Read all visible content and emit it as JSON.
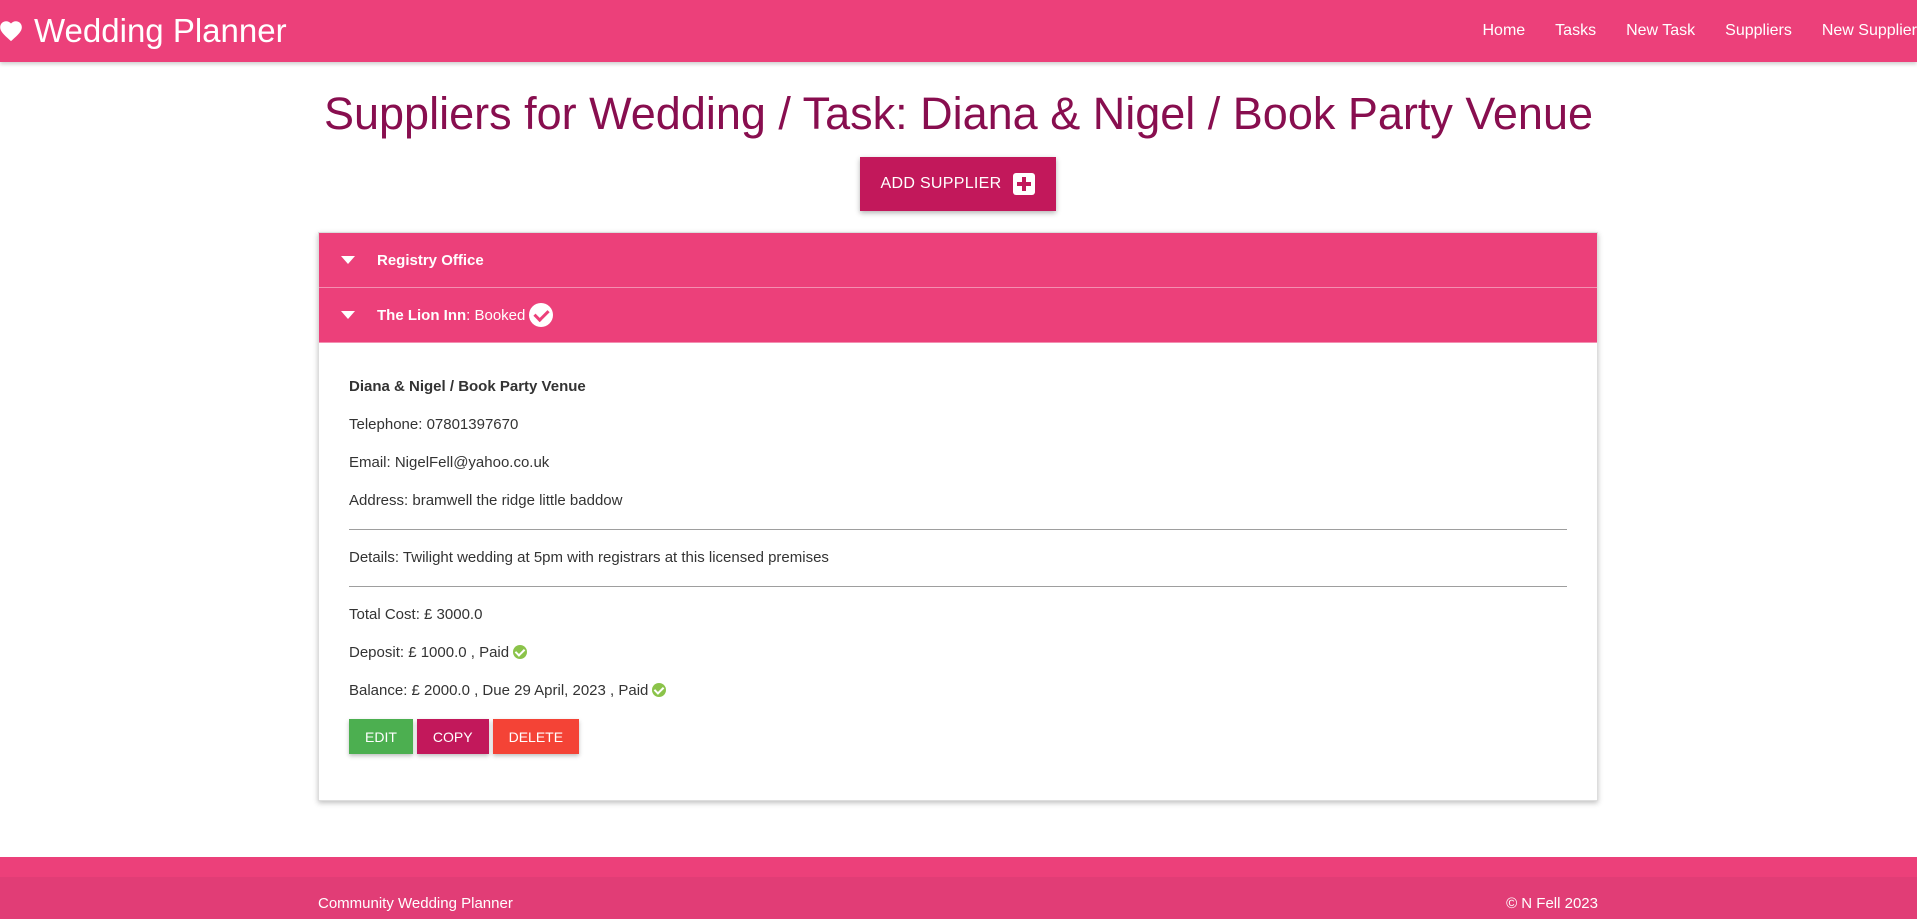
{
  "navbar": {
    "brand": "Wedding Planner",
    "links": [
      "Home",
      "Tasks",
      "New Task",
      "Suppliers",
      "New Supplier"
    ],
    "color": "#ec407a"
  },
  "page": {
    "title": "Suppliers for Wedding / Task: Diana & Nigel / Book Party Venue",
    "add_button": "ADD SUPPLIER"
  },
  "suppliers": [
    {
      "name": "Registry Office",
      "status": ""
    },
    {
      "name": "The Lion Inn",
      "status": ": Booked"
    }
  ],
  "detail": {
    "task": "Diana & Nigel / Book Party Venue",
    "telephone": "Telephone: 07801397670",
    "email": "Email: NigelFell@yahoo.co.uk",
    "address": "Address: bramwell the ridge little baddow",
    "details": "Details: Twilight wedding at 5pm with registrars at this licensed premises",
    "total_cost": "Total Cost: £ 3000.0",
    "deposit": "Deposit: £ 1000.0 , Paid",
    "balance": "Balance: £ 2000.0 , Due 29 April, 2023 , Paid",
    "buttons": {
      "edit": "EDIT",
      "copy": "COPY",
      "delete": "DELETE"
    }
  },
  "footer": {
    "left": "Community Wedding Planner",
    "right": "© N Fell 2023"
  }
}
